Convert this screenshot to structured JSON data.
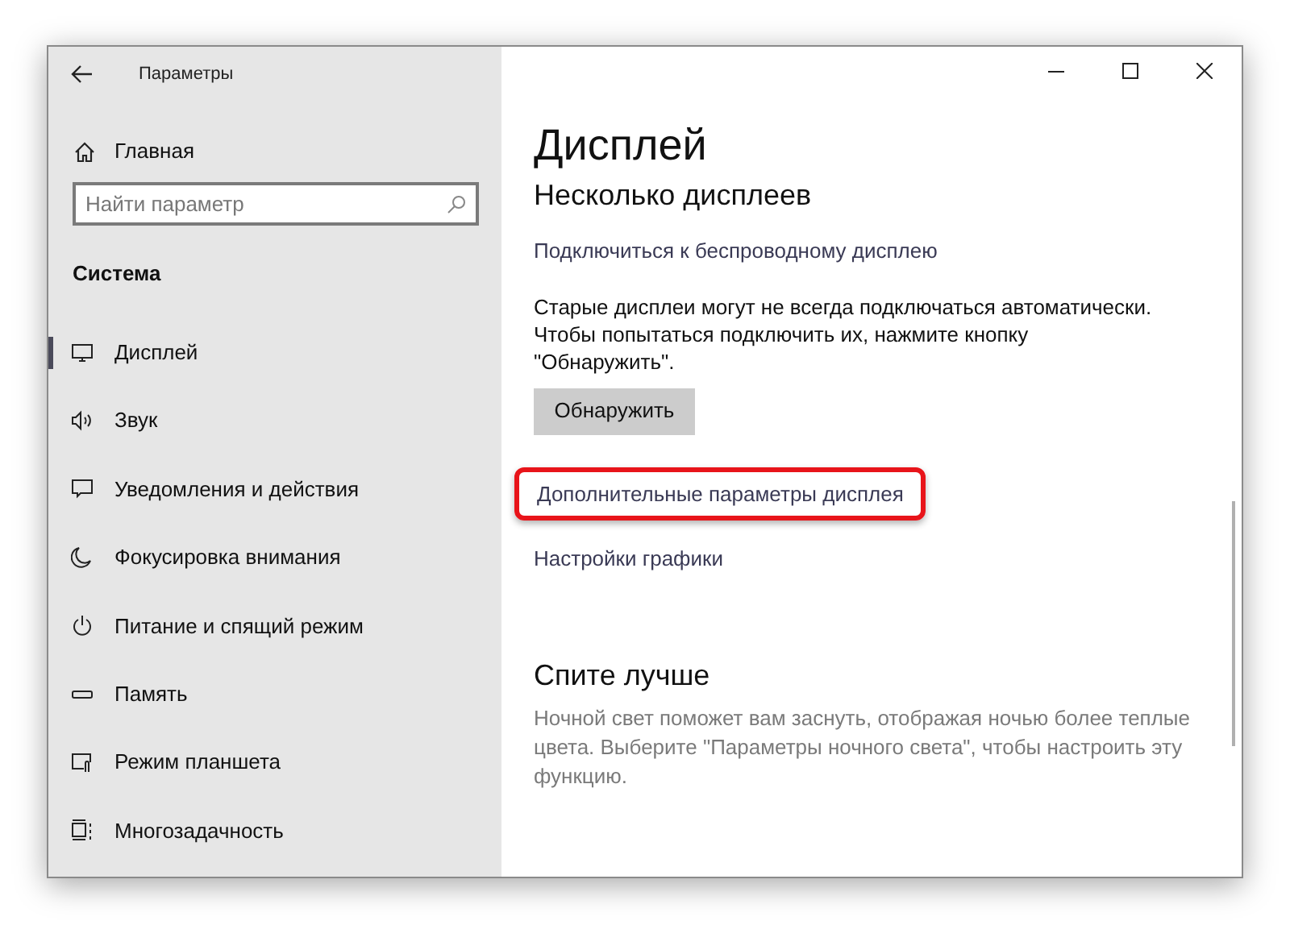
{
  "window": {
    "title": "Параметры"
  },
  "sidebar": {
    "home": "Главная",
    "search": {
      "placeholder": "Найти параметр"
    },
    "section": "Система",
    "items": [
      {
        "label": "Дисплей",
        "selected": true
      },
      {
        "label": "Звук",
        "selected": false
      },
      {
        "label": "Уведомления и действия",
        "selected": false
      },
      {
        "label": "Фокусировка внимания",
        "selected": false
      },
      {
        "label": "Питание и спящий режим",
        "selected": false
      },
      {
        "label": "Память",
        "selected": false
      },
      {
        "label": "Режим планшета",
        "selected": false
      },
      {
        "label": "Многозадачность",
        "selected": false
      }
    ]
  },
  "content": {
    "title": "Дисплей",
    "subtitle": "Несколько дисплеев",
    "wireless_link": "Подключиться к беспроводному дисплею",
    "description": "Старые дисплеи могут не всегда подключаться автоматически. Чтобы попытаться подключить их, нажмите кнопку \"Обнаружить\".",
    "detect_button": "Обнаружить",
    "links": [
      {
        "label": "Дополнительные параметры дисплея",
        "highlighted": true
      },
      {
        "label": "Настройки графики",
        "highlighted": false
      }
    ],
    "sleep_title": "Спите лучше",
    "sleep_text": "Ночной свет поможет вам заснуть, отображая ночью более теплые цвета. Выберите \"Параметры ночного света\", чтобы настроить эту функцию."
  }
}
